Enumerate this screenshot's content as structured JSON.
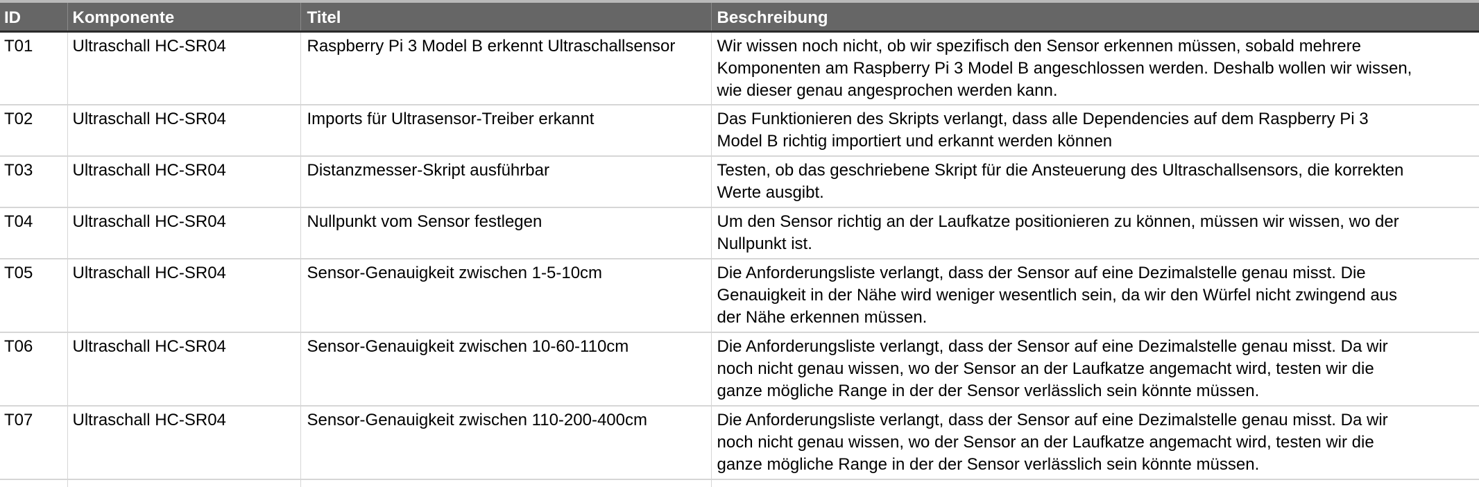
{
  "table": {
    "headers": [
      "ID",
      "Komponente",
      "Titel",
      "Beschreibung"
    ],
    "rows": [
      {
        "id": "T01",
        "komponente": "Ultraschall HC-SR04",
        "titel": "Raspberry Pi 3 Model B erkennt Ultraschallsensor",
        "beschreibung": [
          "Wir wissen noch nicht, ob wir spezifisch den Sensor erkennen müssen, sobald mehrere",
          "Komponenten am Raspberry Pi 3 Model B angeschlossen werden. Deshalb wollen wir wissen,",
          "wie dieser genau angesprochen werden kann."
        ]
      },
      {
        "id": "T02",
        "komponente": "Ultraschall HC-SR04",
        "titel": "Imports für Ultrasensor-Treiber erkannt",
        "beschreibung": [
          "Das Funktionieren des Skripts verlangt, dass alle Dependencies auf dem Raspberry Pi 3",
          "Model B richtig importiert und erkannt werden können"
        ]
      },
      {
        "id": "T03",
        "komponente": "Ultraschall HC-SR04",
        "titel": "Distanzmesser-Skript ausführbar",
        "beschreibung": [
          "Testen, ob das geschriebene Skript für die Ansteuerung des Ultraschallsensors, die korrekten",
          "Werte ausgibt."
        ]
      },
      {
        "id": "T04",
        "komponente": "Ultraschall HC-SR04",
        "titel": "Nullpunkt vom Sensor festlegen",
        "beschreibung": [
          "Um den Sensor richtig an der Laufkatze positionieren zu können, müssen wir wissen, wo der",
          "Nullpunkt ist."
        ]
      },
      {
        "id": "T05",
        "komponente": "Ultraschall HC-SR04",
        "titel": "Sensor-Genauigkeit zwischen 1-5-10cm",
        "beschreibung": [
          "Die Anforderungsliste verlangt, dass der Sensor auf eine Dezimalstelle genau misst. Die",
          "Genauigkeit in der Nähe wird weniger wesentlich sein, da wir den Würfel nicht zwingend aus",
          "der Nähe erkennen müssen."
        ]
      },
      {
        "id": "T06",
        "komponente": "Ultraschall HC-SR04",
        "titel": "Sensor-Genauigkeit zwischen 10-60-110cm",
        "beschreibung": [
          "Die Anforderungsliste verlangt, dass der Sensor auf eine Dezimalstelle genau misst. Da wir",
          "noch nicht genau wissen, wo der Sensor an der Laufkatze angemacht wird, testen wir die",
          "ganze mögliche Range in der der Sensor verlässlich sein könnte müssen."
        ]
      },
      {
        "id": "T07",
        "komponente": "Ultraschall HC-SR04",
        "titel": "Sensor-Genauigkeit zwischen 110-200-400cm",
        "beschreibung": [
          "Die Anforderungsliste verlangt, dass der Sensor auf eine Dezimalstelle genau misst. Da wir",
          "noch nicht genau wissen, wo der Sensor an der Laufkatze angemacht wird, testen wir die",
          "ganze mögliche Range in der der Sensor verlässlich sein könnte müssen."
        ]
      }
    ]
  },
  "colors": {
    "header_bg": "#666666",
    "header_text": "#ffffff",
    "grid_line": "#d6d6d6"
  }
}
